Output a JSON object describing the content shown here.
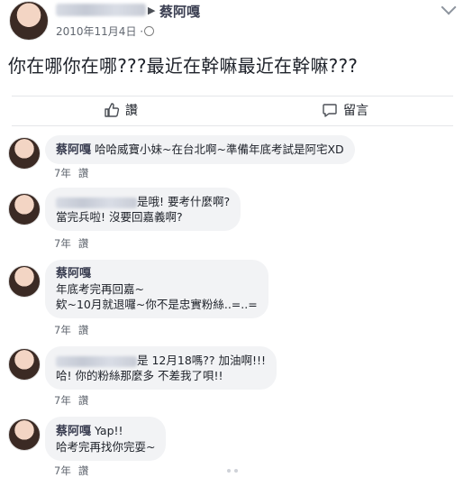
{
  "post": {
    "author": "蔡阿嘎",
    "date": "2010年11月4日 ·",
    "body": "你在哪你在哪???最近在幹嘛最近在幹嘛???"
  },
  "actions": {
    "like_label": "讚",
    "comment_label": "留言"
  },
  "comments": [
    {
      "author": "蔡阿嘎",
      "line1": "哈哈威寶小妹~在台北啊~準備年底考試是阿宅XD",
      "line2": "",
      "line3": "",
      "time": "7年",
      "like": "讚"
    },
    {
      "author": "",
      "line1": "是哦! 要考什麼啊?",
      "line2": "當完兵啦! 沒要回嘉義啊?",
      "line3": "",
      "time": "7年",
      "like": "讚"
    },
    {
      "author": "蔡阿嘎",
      "line1": "",
      "line2": "年底考完再回嘉~",
      "line3": "欸~10月就退囉~你不是忠實粉絲..=..=",
      "time": "7年",
      "like": "讚"
    },
    {
      "author": "",
      "line1": "是 12月18嗎?? 加油啊!!!",
      "line2": "哈! 你的粉絲那麼多 不差我了唄!!",
      "line3": "",
      "time": "7年",
      "like": "讚"
    },
    {
      "author": "蔡阿嘎",
      "line1": "Yap!!",
      "line2": "哈考完再找你完耍~",
      "line3": "",
      "time": "7年",
      "like": "讚"
    }
  ],
  "icons": {
    "like": "thumbs-up-icon",
    "comment": "comment-bubble-icon",
    "privacy": "globe-icon",
    "menu": "chevron-down-icon"
  }
}
